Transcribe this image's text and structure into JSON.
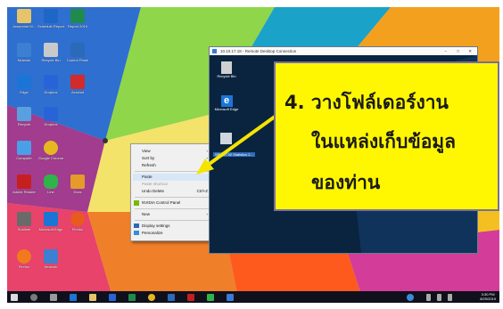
{
  "desktop_icons": [
    {
      "label": "Josephine M..."
    },
    {
      "label": "Schedule Report"
    },
    {
      "label": "Report 2019"
    },
    {
      "label": "Network"
    },
    {
      "label": "Recycle Bin"
    },
    {
      "label": "Control Panel"
    },
    {
      "label": "Edge"
    },
    {
      "label": "Dropbox"
    },
    {
      "label": "Acrobat"
    },
    {
      "label": "Recycle"
    },
    {
      "label": "Dropbox"
    },
    {
      "label": "Computer"
    },
    {
      "label": "Google Chrome"
    },
    {
      "label": "Adobe Reader"
    },
    {
      "label": "Line"
    },
    {
      "label": "Docs"
    },
    {
      "label": "Sublime"
    },
    {
      "label": "Microsoft Edge"
    },
    {
      "label": "Firefox"
    },
    {
      "label": "Firefox"
    },
    {
      "label": "Network"
    }
  ],
  "context_menu": {
    "items": [
      {
        "label": "View",
        "disabled": false
      },
      {
        "label": "Sort by",
        "disabled": false
      },
      {
        "label": "Refresh",
        "disabled": false
      },
      {
        "label": "Paste",
        "disabled": false,
        "highlighted": true
      },
      {
        "label": "Paste shortcut",
        "disabled": true
      },
      {
        "label": "Undo Delete",
        "shortcut": "Ctrl+Z",
        "disabled": false
      },
      {
        "label": "NVIDIA Control Panel",
        "disabled": false
      },
      {
        "label": "New",
        "disabled": false,
        "submenu": true
      },
      {
        "label": "Display settings",
        "disabled": false
      },
      {
        "label": "Personalize",
        "disabled": false
      }
    ]
  },
  "remote_window": {
    "title": "10.10.17.18 - Remote Desktop Connection",
    "icons": [
      {
        "label": "Recycle Bin"
      },
      {
        "label": "Microsoft Edge"
      },
      {
        "label": "SPP 57 02 Statistics 2..."
      }
    ]
  },
  "callout": {
    "line1": "4. วางโฟล์เดอร์งาน",
    "line2": "ในแหล่งเก็บข้อมูล",
    "line3": "ของท่าน"
  },
  "taskbar": {
    "clock_time": "3:30 PM",
    "clock_date": "8/29/2019"
  },
  "colors": {
    "callout_bg": "#fff701",
    "arrow": "#f4e400",
    "taskbar": "#10101c",
    "remote_bg": "#0a2440"
  }
}
